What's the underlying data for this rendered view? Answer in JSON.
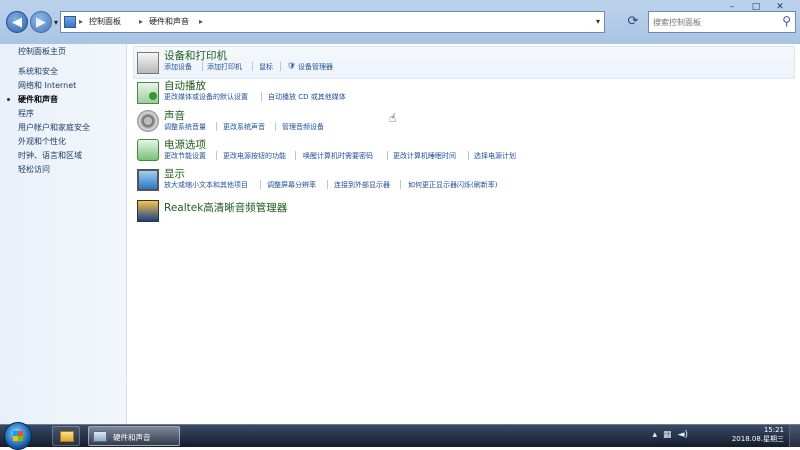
{
  "window": {
    "breadcrumbs": [
      "控制面板",
      "硬件和声音"
    ],
    "search_placeholder": "搜索控制面板",
    "controls": {
      "minimize": "–",
      "maximize": "□",
      "close": "✕"
    }
  },
  "left_nav": {
    "items": [
      {
        "label": "控制面板主页"
      },
      {
        "label": "系统和安全"
      },
      {
        "label": "网络和 Internet"
      },
      {
        "label": "硬件和声音",
        "current": true
      },
      {
        "label": "程序"
      },
      {
        "label": "用户帐户和家庭安全"
      },
      {
        "label": "外观和个性化"
      },
      {
        "label": "时钟、语言和区域"
      },
      {
        "label": "轻松访问"
      }
    ]
  },
  "categories": [
    {
      "title": "设备和打印机",
      "icon": "printer-icon",
      "links": [
        "添加设备",
        "添加打印机",
        "鼠标",
        "设备管理器"
      ]
    },
    {
      "title": "自动播放",
      "icon": "autoplay-icon",
      "links": [
        "更改媒体或设备的默认设置",
        "自动播放 CD 或其他媒体"
      ]
    },
    {
      "title": "声音",
      "icon": "speaker-icon",
      "links": [
        "调整系统音量",
        "更改系统声音",
        "管理音频设备"
      ]
    },
    {
      "title": "电源选项",
      "icon": "power-options-icon",
      "links": [
        "更改节能设置",
        "更改电源按钮的功能",
        "唤醒计算机时需要密码",
        "更改计算机睡眠时间",
        "选择电源计划"
      ]
    },
    {
      "title": "显示",
      "icon": "display-icon",
      "links": [
        "放大或缩小文本和其他项目",
        "调整屏幕分辨率",
        "连接到外部显示器",
        "如何更正显示器闪烁(刷新率)"
      ]
    },
    {
      "title": "Realtek高清晰音频管理器",
      "icon": "realtek-icon",
      "links": []
    }
  ],
  "taskbar": {
    "active_window": "硬件和声音",
    "time": "15:21",
    "date": "2018.08.星期三"
  },
  "colors": {
    "link": "#1f4f9a",
    "category_title": "#1e5b1e",
    "nav_link": "#1d3d6b"
  }
}
